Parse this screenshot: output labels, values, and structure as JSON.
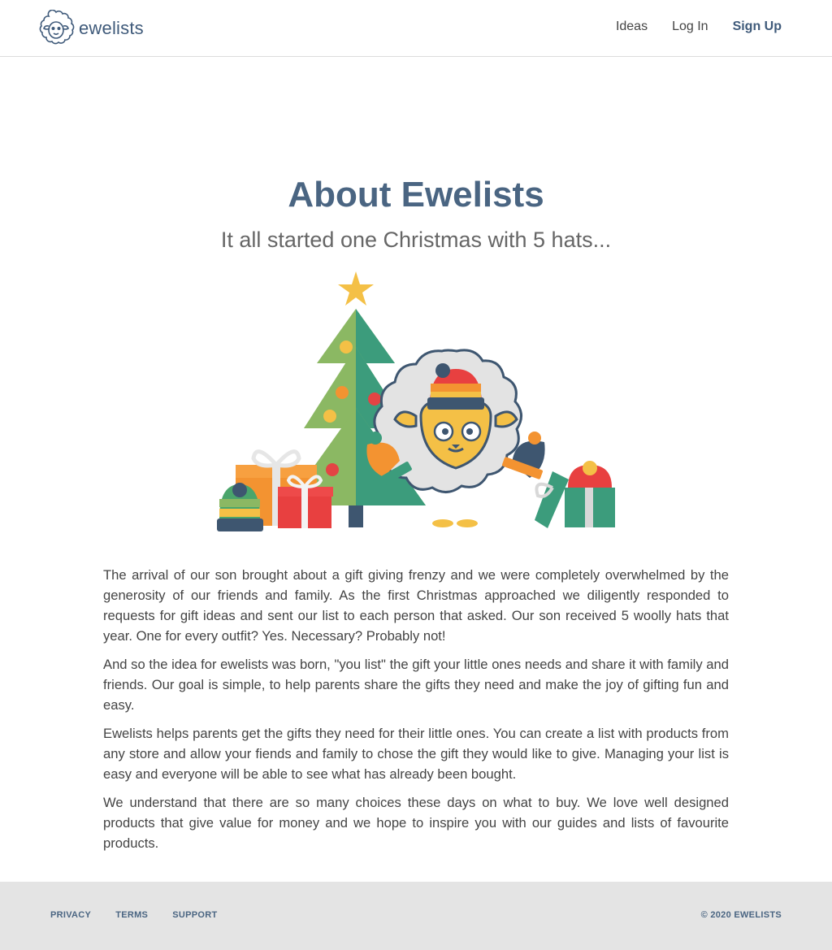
{
  "header": {
    "brand": "ewelists",
    "nav": {
      "ideas": "Ideas",
      "login": "Log In",
      "signup": "Sign Up"
    }
  },
  "main": {
    "title": "About Ewelists",
    "subtitle": "It all started one Christmas with 5 hats...",
    "paragraphs": [
      "The arrival of our son brought about a gift giving frenzy and we were completely overwhelmed by the generosity of our friends and family. As the first Christmas approached we diligently responded to requests for gift ideas and sent our list to each person that asked. Our son received 5 woolly hats that year. One for every outfit? Yes. Necessary? Probably not!",
      "And so the idea for ewelists was born, \"you list\" the gift your little ones needs and share it with family and friends. Our goal is simple, to help parents share the gifts they need and make the joy of gifting fun and easy.",
      "Ewelists helps parents get the gifts they need for their little ones. You can create a list with products from any store and allow your fiends and family to chose the gift they would like to give. Managing your list is easy and everyone will be able to see what has already been bought.",
      "We understand that there are so many choices these days on what to buy. We love well designed products that give value for money and we hope to inspire you with our guides and lists of favourite products."
    ]
  },
  "footer": {
    "links": {
      "privacy": "PRIVACY",
      "terms": "TERMS",
      "support": "SUPPORT"
    },
    "copyright": "© 2020 EWELISTS"
  },
  "colors": {
    "brand": "#3f5a7a",
    "heading": "#4a6582",
    "footer_bg": "#e4e4e4"
  }
}
